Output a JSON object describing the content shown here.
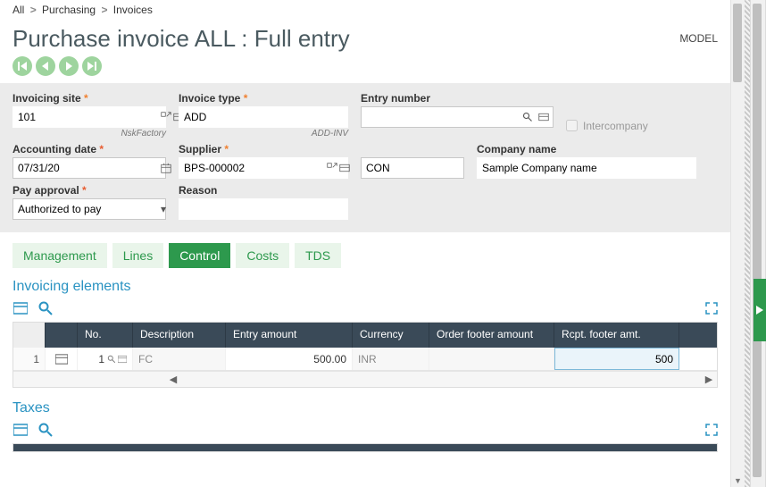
{
  "breadcrumb": [
    "All",
    "Purchasing",
    "Invoices"
  ],
  "page_title": "Purchase invoice ALL : Full entry",
  "model_label": "MODEL",
  "header": {
    "invoicing_site": {
      "label": "Invoicing site",
      "value": "101",
      "caption": "NskFactory"
    },
    "invoice_type": {
      "label": "Invoice type",
      "value": "ADD",
      "caption": "ADD-INV"
    },
    "entry_number": {
      "label": "Entry number",
      "value": ""
    },
    "intercompany": {
      "label": "Intercompany",
      "checked": false
    },
    "accounting_date": {
      "label": "Accounting date",
      "value": "07/31/20"
    },
    "supplier": {
      "label": "Supplier",
      "value": "BPS-000002"
    },
    "supplier_code": {
      "label": "",
      "value": "CON"
    },
    "company_name": {
      "label": "Company name",
      "value": "Sample Company name"
    },
    "pay_approval": {
      "label": "Pay approval",
      "value": "Authorized to pay"
    },
    "reason": {
      "label": "Reason",
      "value": ""
    }
  },
  "tabs": [
    {
      "id": "management",
      "label": "Management",
      "active": false
    },
    {
      "id": "lines",
      "label": "Lines",
      "active": false
    },
    {
      "id": "control",
      "label": "Control",
      "active": true
    },
    {
      "id": "costs",
      "label": "Costs",
      "active": false
    },
    {
      "id": "tds",
      "label": "TDS",
      "active": false
    }
  ],
  "sections": {
    "invoicing_elements": {
      "title": "Invoicing elements",
      "columns": [
        "",
        "",
        "No.",
        "Description",
        "Entry amount",
        "Currency",
        "Order footer amount",
        "Rcpt. footer amt."
      ],
      "rows": [
        {
          "index": "1",
          "no": "1",
          "description": "FC",
          "entry_amount": "500.00",
          "currency": "INR",
          "order_footer_amount": "",
          "rcpt_footer_amt": "500"
        }
      ]
    },
    "taxes": {
      "title": "Taxes"
    }
  }
}
